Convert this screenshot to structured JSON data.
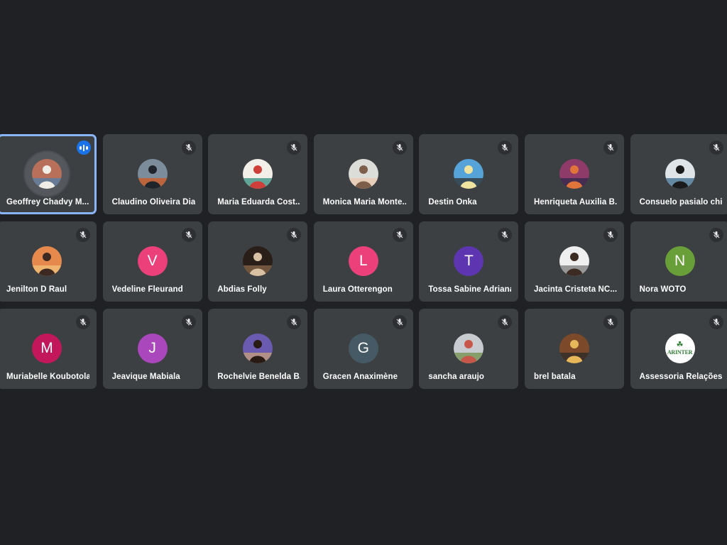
{
  "colors": {
    "background": "#202124",
    "tile": "#3c4043",
    "speaking_border": "#8ab4f8",
    "speaking_indicator": "#1a73e8"
  },
  "participants": [
    {
      "name": "Geoffrey Chadvy M...",
      "avatar": "photo",
      "icon": "speaking-indicator-icon",
      "speaking": true,
      "photo": {
        "bg": "#b8705a",
        "fg": "#f0ece6",
        "accent": "#4c7fa8"
      }
    },
    {
      "name": "Claudino Oliveira Dias",
      "avatar": "photo",
      "icon": "mic-off-icon",
      "photo": {
        "bg": "#7c8c9a",
        "fg": "#20252b",
        "accent": "#d2581e"
      }
    },
    {
      "name": "Maria Eduarda Cost...",
      "avatar": "photo",
      "icon": "mic-off-icon",
      "photo": {
        "bg": "#f1efe8",
        "fg": "#ce3f3a",
        "accent": "#2f8c7c"
      }
    },
    {
      "name": "Monica Maria Monte...",
      "avatar": "photo",
      "icon": "mic-off-icon",
      "photo": {
        "bg": "#dcdcd8",
        "fg": "#7c5e4a",
        "accent": "#e9c9b2"
      }
    },
    {
      "name": "Destin Onka",
      "avatar": "photo",
      "icon": "mic-off-icon",
      "photo": {
        "bg": "#55a3d8",
        "fg": "#efe3a0",
        "accent": "#2e2e2e"
      }
    },
    {
      "name": "Henriqueta Auxilia B...",
      "avatar": "photo",
      "icon": "mic-off-icon",
      "photo": {
        "bg": "#8e3b69",
        "fg": "#e0743a",
        "accent": "#2c2a4a"
      }
    },
    {
      "name": "Consuelo pasialo chi...",
      "avatar": "photo",
      "icon": "mic-off-icon",
      "photo": {
        "bg": "#dfe4e8",
        "fg": "#1b1b1b",
        "accent": "#3b6b8c"
      }
    },
    {
      "name": "Jenilton D Raul",
      "avatar": "photo",
      "icon": "mic-off-icon",
      "photo": {
        "bg": "#e58a4c",
        "fg": "#3c2a22",
        "accent": "#f3c27a"
      }
    },
    {
      "name": "Vedeline Fleurand",
      "avatar": "initial",
      "initial": "V",
      "color": "#ec407a",
      "icon": "mic-off-icon"
    },
    {
      "name": "Abdias Folly",
      "avatar": "photo",
      "icon": "mic-off-icon",
      "photo": {
        "bg": "#2a1e18",
        "fg": "#d8c1a2",
        "accent": "#8a6a4a"
      }
    },
    {
      "name": "Laura Otterengon",
      "avatar": "initial",
      "initial": "L",
      "color": "#ec407a",
      "icon": "mic-off-icon"
    },
    {
      "name": "Tossa Sabine Adriana",
      "avatar": "initial",
      "initial": "T",
      "color": "#5e35b1",
      "icon": "mic-off-icon"
    },
    {
      "name": "Jacinta Cristeta NC...",
      "avatar": "photo",
      "icon": "mic-off-icon",
      "photo": {
        "bg": "#efefef",
        "fg": "#3b2b22",
        "accent": "#7a7a7a"
      }
    },
    {
      "name": "Nora WOTO",
      "avatar": "initial",
      "initial": "N",
      "color": "#689f38",
      "icon": "mic-off-icon"
    },
    {
      "name": "Muriabelle Koubotola",
      "avatar": "initial",
      "initial": "M",
      "color": "#c2185b",
      "icon": "mic-off-icon"
    },
    {
      "name": "Jeavique Mabiala",
      "avatar": "initial",
      "initial": "J",
      "color": "#ab47bc",
      "icon": "mic-off-icon"
    },
    {
      "name": "Rochelvie Benelda B...",
      "avatar": "photo",
      "icon": "mic-off-icon",
      "photo": {
        "bg": "#6a5bb0",
        "fg": "#2a1a14",
        "accent": "#c9a07a"
      }
    },
    {
      "name": "Gracen Anaximène",
      "avatar": "initial",
      "initial": "G",
      "color": "#455a64",
      "icon": "mic-off-icon"
    },
    {
      "name": "sancha araujo",
      "avatar": "photo",
      "icon": "mic-off-icon",
      "photo": {
        "bg": "#c8ccd0",
        "fg": "#c6574a",
        "accent": "#6f8f4a"
      }
    },
    {
      "name": "brel batala",
      "avatar": "photo",
      "icon": "mic-off-icon",
      "photo": {
        "bg": "#7c4a2a",
        "fg": "#e7b85a",
        "accent": "#2a2a2a"
      }
    },
    {
      "name": "Assessoria Relações...",
      "avatar": "logo",
      "logo_text": "ARINTER",
      "icon": "mic-off-icon"
    }
  ]
}
